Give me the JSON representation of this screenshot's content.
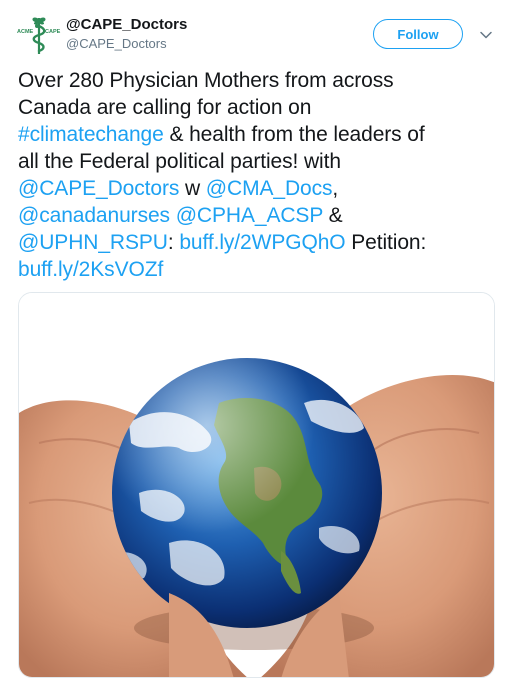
{
  "account": {
    "avatar_text_left": "ACME",
    "avatar_text_right": "CAPE",
    "display_name": "@CAPE_Doctors",
    "handle": "@CAPE_Doctors"
  },
  "actions": {
    "follow_label": "Follow",
    "more_icon": "chevron-down-icon"
  },
  "tweet": {
    "lines": [
      [
        {
          "t": "Over 280 Physician Mothers from across",
          "link": false
        }
      ],
      [
        {
          "t": "Canada are calling for action on",
          "link": false
        }
      ],
      [
        {
          "t": "#climatechange",
          "link": true
        },
        {
          "t": " & health from the leaders of",
          "link": false
        }
      ],
      [
        {
          "t": "all the Federal political parties! with",
          "link": false
        }
      ],
      [
        {
          "t": "@CAPE_Doctors",
          "link": true
        },
        {
          "t": " w ",
          "link": false
        },
        {
          "t": "@CMA_Docs",
          "link": true
        },
        {
          "t": ",",
          "link": false
        }
      ],
      [
        {
          "t": "@canadanurses",
          "link": true
        },
        {
          "t": " ",
          "link": false
        },
        {
          "t": "@CPHA_ACSP",
          "link": true
        },
        {
          "t": " &",
          "link": false
        }
      ],
      [
        {
          "t": "@UPHN_RSPU",
          "link": true
        },
        {
          "t": ": ",
          "link": false
        },
        {
          "t": "buff.ly/2WPGQhO",
          "link": true
        },
        {
          "t": " Petition:",
          "link": false
        }
      ],
      [
        {
          "t": "buff.ly/2KsVOZf",
          "link": true
        }
      ]
    ]
  },
  "media": {
    "image": "hands-holding-earth-globe"
  },
  "colors": {
    "link": "#1da1f2",
    "text": "#14171a",
    "secondary": "#657786",
    "logo_green": "#2e8b57"
  }
}
